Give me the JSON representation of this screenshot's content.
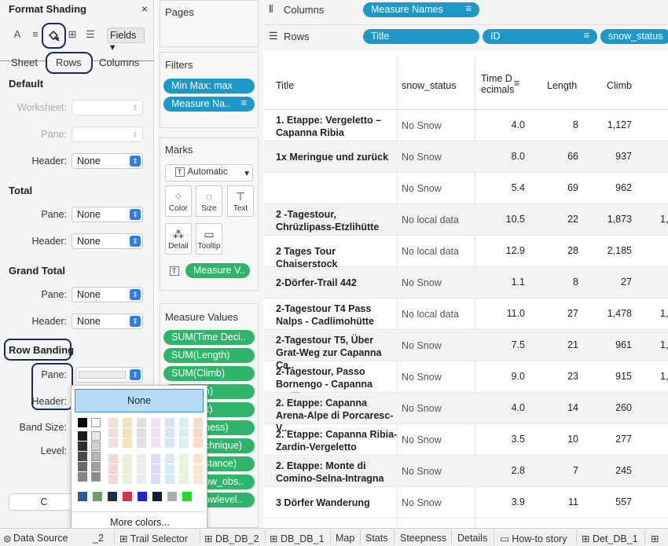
{
  "format_panel": {
    "title": "Format Shading",
    "close": "×",
    "fields": "Fields",
    "tabs": [
      "Sheet",
      "Rows",
      "Columns"
    ],
    "default": {
      "title": "Default",
      "worksheet": "Worksheet:",
      "pane": "Pane:",
      "header": "Header:",
      "header_value": "None"
    },
    "total": {
      "title": "Total",
      "pane": "Pane:",
      "pane_value": "None",
      "header": "Header:",
      "header_value": "None"
    },
    "grand_total": {
      "title": "Grand Total",
      "pane": "Pane:",
      "pane_value": "None",
      "header": "Header:",
      "header_value": "None"
    },
    "row_banding": {
      "title": "Row Banding",
      "pane": "Pane:",
      "header": "Header:",
      "band_size": "Band Size:",
      "level": "Level:"
    },
    "clear_stub": "C"
  },
  "pages": {
    "title": "Pages"
  },
  "filters": {
    "title": "Filters",
    "pills": [
      "Min Max: max",
      "Measure Na.."
    ]
  },
  "marks": {
    "title": "Marks",
    "type": "Automatic",
    "buttons": [
      "Color",
      "Size",
      "Text",
      "Detail",
      "Tooltip"
    ],
    "pill": "Measure V.."
  },
  "measure_values": {
    "title": "Measure Values",
    "pills": [
      "SUM(Time Deci..",
      "SUM(Length)",
      "SUM(Climb)",
      "n)",
      "x)",
      "ness)",
      "chnique)",
      "stance)",
      "ow_obs..",
      "owlevel.."
    ]
  },
  "columns_shelf": {
    "label": "Columns",
    "pill": "Measure Names"
  },
  "rows_shelf": {
    "label": "Rows",
    "pills": [
      "Title",
      "ID",
      "snow_status"
    ]
  },
  "table": {
    "headers": {
      "title": "Title",
      "snow": "snow_status",
      "time1": "Time D",
      "time2": "ecimals",
      "length": "Length",
      "climb": "Climb"
    },
    "rows": [
      {
        "title": "1. Etappe: Vergeletto – Capanna Ribia",
        "snow": "No Snow",
        "time": "4.0",
        "length": "8",
        "climb": "1,127",
        "extra": ""
      },
      {
        "title": "1x Meringue und zurück",
        "snow": "No Snow",
        "time": "8.0",
        "length": "66",
        "climb": "937",
        "extra": ""
      },
      {
        "title": "",
        "snow": "No Snow",
        "time": "5.4",
        "length": "69",
        "climb": "962",
        "extra": ""
      },
      {
        "title": "2 -Tagestour, Chrüzlipass-Etzlihütte",
        "snow": "No local data",
        "time": "10.5",
        "length": "22",
        "climb": "1,873",
        "extra": "1,"
      },
      {
        "title": "2 Tages Tour Chaiserstock",
        "snow": "No local data",
        "time": "12.9",
        "length": "28",
        "climb": "2,185",
        "extra": ""
      },
      {
        "title": "2-Dörfer-Trail 442",
        "snow": "No Snow",
        "time": "1.1",
        "length": "8",
        "climb": "27",
        "extra": ""
      },
      {
        "title": "2-Tagestour T4 Pass Nalps - Cadlimohütte",
        "snow": "No local data",
        "time": "11.0",
        "length": "27",
        "climb": "1,478",
        "extra": "1,"
      },
      {
        "title": "2-Tagestour T5, Über Grat-Weg zur Capanna Ca..",
        "snow": "No Snow",
        "time": "7.5",
        "length": "21",
        "climb": "961",
        "extra": "1,"
      },
      {
        "title": "2-Tagestour,  Passo Bornengo - Capanna Cadli..",
        "snow": "No Snow",
        "time": "9.0",
        "length": "23",
        "climb": "915",
        "extra": "1,"
      },
      {
        "title": "2. Etappe: Capanna Arena-Alpe di Porcaresc-V..",
        "snow": "No Snow",
        "time": "4.0",
        "length": "14",
        "climb": "260",
        "extra": ""
      },
      {
        "title": "2. Etappe: Capanna Ribia-Zardin-Vergeletto",
        "snow": "No Snow",
        "time": "3.5",
        "length": "10",
        "climb": "277",
        "extra": ""
      },
      {
        "title": "2. Etappe: Monte di Comino-Selna-Intragna",
        "snow": "No Snow",
        "time": "2.8",
        "length": "7",
        "climb": "245",
        "extra": ""
      },
      {
        "title": "3 Dörfer Wanderung",
        "snow": "No Snow",
        "time": "3.9",
        "length": "11",
        "climb": "557",
        "extra": ""
      }
    ]
  },
  "color_popup": {
    "none": "None",
    "more": "More colors..."
  },
  "bottom_tabs": [
    "Data Source",
    "_2",
    "Trail Selector",
    "DB_DB_2",
    "DB_DB_1",
    "Map",
    "Stats",
    "Steepness",
    "Details",
    "How-to story",
    "Det_DB_1"
  ],
  "colors": {
    "accent": "#2eb56a",
    "highlight": "#1a2b5e",
    "selection": "#b7dbf7"
  }
}
